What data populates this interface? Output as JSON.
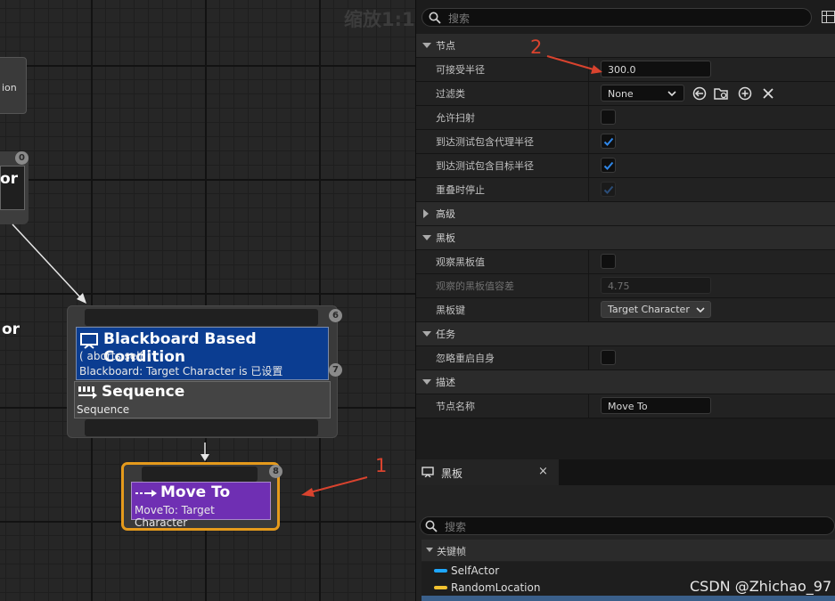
{
  "graph": {
    "zoom_label": "缩放1:1",
    "left_node_fragment_1": "ion",
    "left_node_fragment_2": "or",
    "left_pin_index": "0",
    "composite_node": {
      "top_pin_index": "6",
      "decorator": {
        "title": "Blackboard Based Condition",
        "line1": "( aborts self )",
        "line2": "Blackboard: Target Character is 已设置",
        "pin_index": "7"
      },
      "sequence": {
        "title": "Sequence",
        "subtitle": "Sequence"
      }
    },
    "task_node": {
      "title": "Move To",
      "subtitle": "MoveTo: Target Character",
      "pin_index": "8"
    },
    "annotation_1": "1",
    "annotation_2": "2",
    "arrow_color": "#d9432e",
    "decorator_color": "#0b3d91",
    "task_color": "#6f2fb3",
    "selected_border_color": "#e59a1c"
  },
  "details": {
    "search_placeholder": "搜索",
    "sections": {
      "node": "节点",
      "advanced": "高级",
      "blackboard": "黑板",
      "task": "任务",
      "description": "描述"
    },
    "props": {
      "acceptable_radius_label": "可接受半径",
      "acceptable_radius_value": "300.0",
      "filter_class_label": "过滤类",
      "filter_class_value": "None",
      "allow_strafe_label": "允许扫射",
      "include_agent_radius_label": "到达测试包含代理半径",
      "include_goal_radius_label": "到达测试包含目标半径",
      "stop_on_overlap_label": "重叠时停止",
      "observe_bb_value_label": "观察黑板值",
      "observed_tolerance_label": "观察的黑板值容差",
      "observed_tolerance_value": "4.75",
      "bb_key_label": "黑板键",
      "bb_key_value": "Target Character",
      "ignore_restart_self_label": "忽略重启自身",
      "node_name_label": "节点名称",
      "node_name_value": "Move To"
    },
    "checkbox_state": {
      "allow_strafe": false,
      "include_agent_radius": true,
      "include_goal_radius": true,
      "stop_on_overlap": true,
      "observe_bb_value": false,
      "ignore_restart_self": false
    }
  },
  "blackboard_panel": {
    "tab_label": "黑板",
    "close_label": "×",
    "search_placeholder": "搜索",
    "section_label": "关键帧",
    "keys": [
      {
        "name": "SelfActor",
        "color": "#1ea7ff"
      },
      {
        "name": "RandomLocation",
        "color": "#f2c230"
      }
    ]
  },
  "watermark": "CSDN @Zhichao_97"
}
